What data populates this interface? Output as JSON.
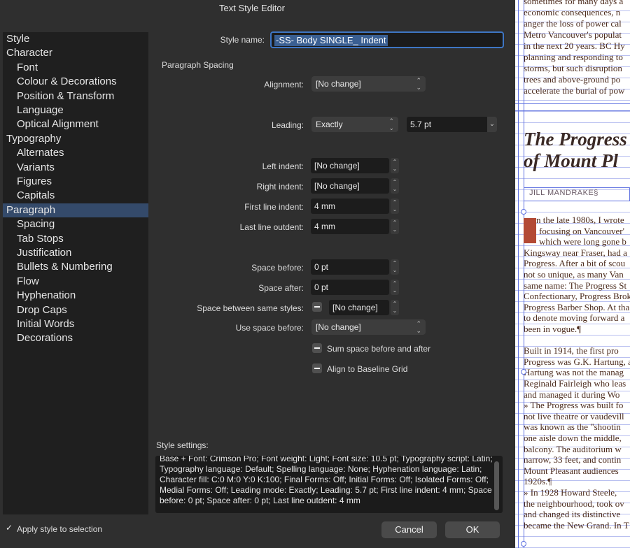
{
  "window": {
    "title": "Text Style Editor"
  },
  "sidebar": {
    "items": [
      {
        "label": "Style",
        "level": 0
      },
      {
        "label": "Character",
        "level": 0
      },
      {
        "label": "Font",
        "level": 1
      },
      {
        "label": "Colour & Decorations",
        "level": 1
      },
      {
        "label": "Position & Transform",
        "level": 1
      },
      {
        "label": "Language",
        "level": 1
      },
      {
        "label": "Optical Alignment",
        "level": 1
      },
      {
        "label": "Typography",
        "level": 0
      },
      {
        "label": "Alternates",
        "level": 1
      },
      {
        "label": "Variants",
        "level": 1
      },
      {
        "label": "Figures",
        "level": 1
      },
      {
        "label": "Capitals",
        "level": 1
      },
      {
        "label": "Paragraph",
        "level": 0,
        "selected": true
      },
      {
        "label": "Spacing",
        "level": 1
      },
      {
        "label": "Tab Stops",
        "level": 1
      },
      {
        "label": "Justification",
        "level": 1
      },
      {
        "label": "Bullets & Numbering",
        "level": 1
      },
      {
        "label": "Flow",
        "level": 1
      },
      {
        "label": "Hyphenation",
        "level": 1
      },
      {
        "label": "Drop Caps",
        "level": 1
      },
      {
        "label": "Initial Words",
        "level": 1
      },
      {
        "label": "Decorations",
        "level": 1
      }
    ]
  },
  "form": {
    "style_name_label": "Style name:",
    "style_name_value": "-SS- Body SINGLE_ Indent",
    "section_title": "Paragraph Spacing",
    "alignment": {
      "label": "Alignment:",
      "value": "[No change]"
    },
    "leading": {
      "label": "Leading:",
      "mode": "Exactly",
      "value": "5.7 pt"
    },
    "left_indent": {
      "label": "Left indent:",
      "value": "[No change]"
    },
    "right_indent": {
      "label": "Right indent:",
      "value": "[No change]"
    },
    "first_line_indent": {
      "label": "First line indent:",
      "value": "4 mm"
    },
    "last_line_outdent": {
      "label": "Last line outdent:",
      "value": "4 mm"
    },
    "space_before": {
      "label": "Space before:",
      "value": "0 pt"
    },
    "space_after": {
      "label": "Space after:",
      "value": "0 pt"
    },
    "space_between": {
      "label": "Space between same styles:",
      "value": "[No change]"
    },
    "use_space_before": {
      "label": "Use space before:",
      "value": "[No change]"
    },
    "sum_space": {
      "label": "Sum space before and after"
    },
    "align_baseline": {
      "label": "Align to Baseline Grid"
    }
  },
  "settings": {
    "label": "Style settings:",
    "text": "Base + Font: Crimson Pro; Font weight: Light; Font size: 10.5 pt; Typography script: Latin; Typography language: Default; Spelling language: None; Hyphenation language: Latin; Character fill: C:0 M:0 Y:0 K:100; Final Forms: Off; Initial Forms: Off; Isolated Forms: Off; Medial Forms: Off; Leading mode: Exactly; Leading: 5.7 pt; First line indent: 4 mm; Space before: 0 pt; Space after: 0 pt; Last line outdent: 4 mm"
  },
  "footer": {
    "apply_label": "Apply style to selection",
    "apply_checked": true,
    "cancel_label": "Cancel",
    "ok_label": "OK"
  },
  "document": {
    "top_lines": [
      "sometimes for many days a",
      "economic consequences, n",
      "anger the loss of power cal",
      "Metro Vancouver's populat",
      "in the next 20 years. BC Hy",
      "planning and responding to",
      "storms, but such disruption",
      "trees and above-ground po",
      "accelerate the burial of pow"
    ],
    "heading_lines": [
      "The Progress",
      "of Mount Pl"
    ],
    "byline": "JILL MANDRAKE§",
    "body_lines": [
      "n the late 1980s, I wrote",
      "focusing on Vancouver'",
      "which were long gone b",
      "Kingsway near Fraser, had a",
      "Progress.   After a bit of scou",
      "not so unique, as many Van",
      "same name:  The Progress St",
      "Confectionary, Progress Broke",
      "Progress Barber Shop.   At tha",
      "to denote moving forward a",
      "been in vogue.¶",
      "",
      "     Built in 1914, the first pro",
      "Progress was G.K. Hartung, a",
      "Hartung was not the manag",
      "Reginald Fairleigh who leas",
      "and managed it during Wo",
      "   » The Progress was built fo",
      "not live theatre or vaudevill",
      "was known as the \"shootin",
      "one aisle down the middle,",
      "balcony.  The auditorium w",
      "narrow, 33 feet, and contin",
      "Mount Pleasant audiences",
      "1920s.¶",
      "   » In 1928 Howard Steele,",
      "the neighbourhood, took ov",
      "and changed its distinctive",
      "became the New Grand.  In T"
    ]
  },
  "colors": {
    "accent": "#3e76c4",
    "sidebar_selected": "#344a6a",
    "dialog_bg": "#2f2f2f",
    "guide_blue": "#5c6fe0",
    "dropcap": "#b34a35"
  }
}
